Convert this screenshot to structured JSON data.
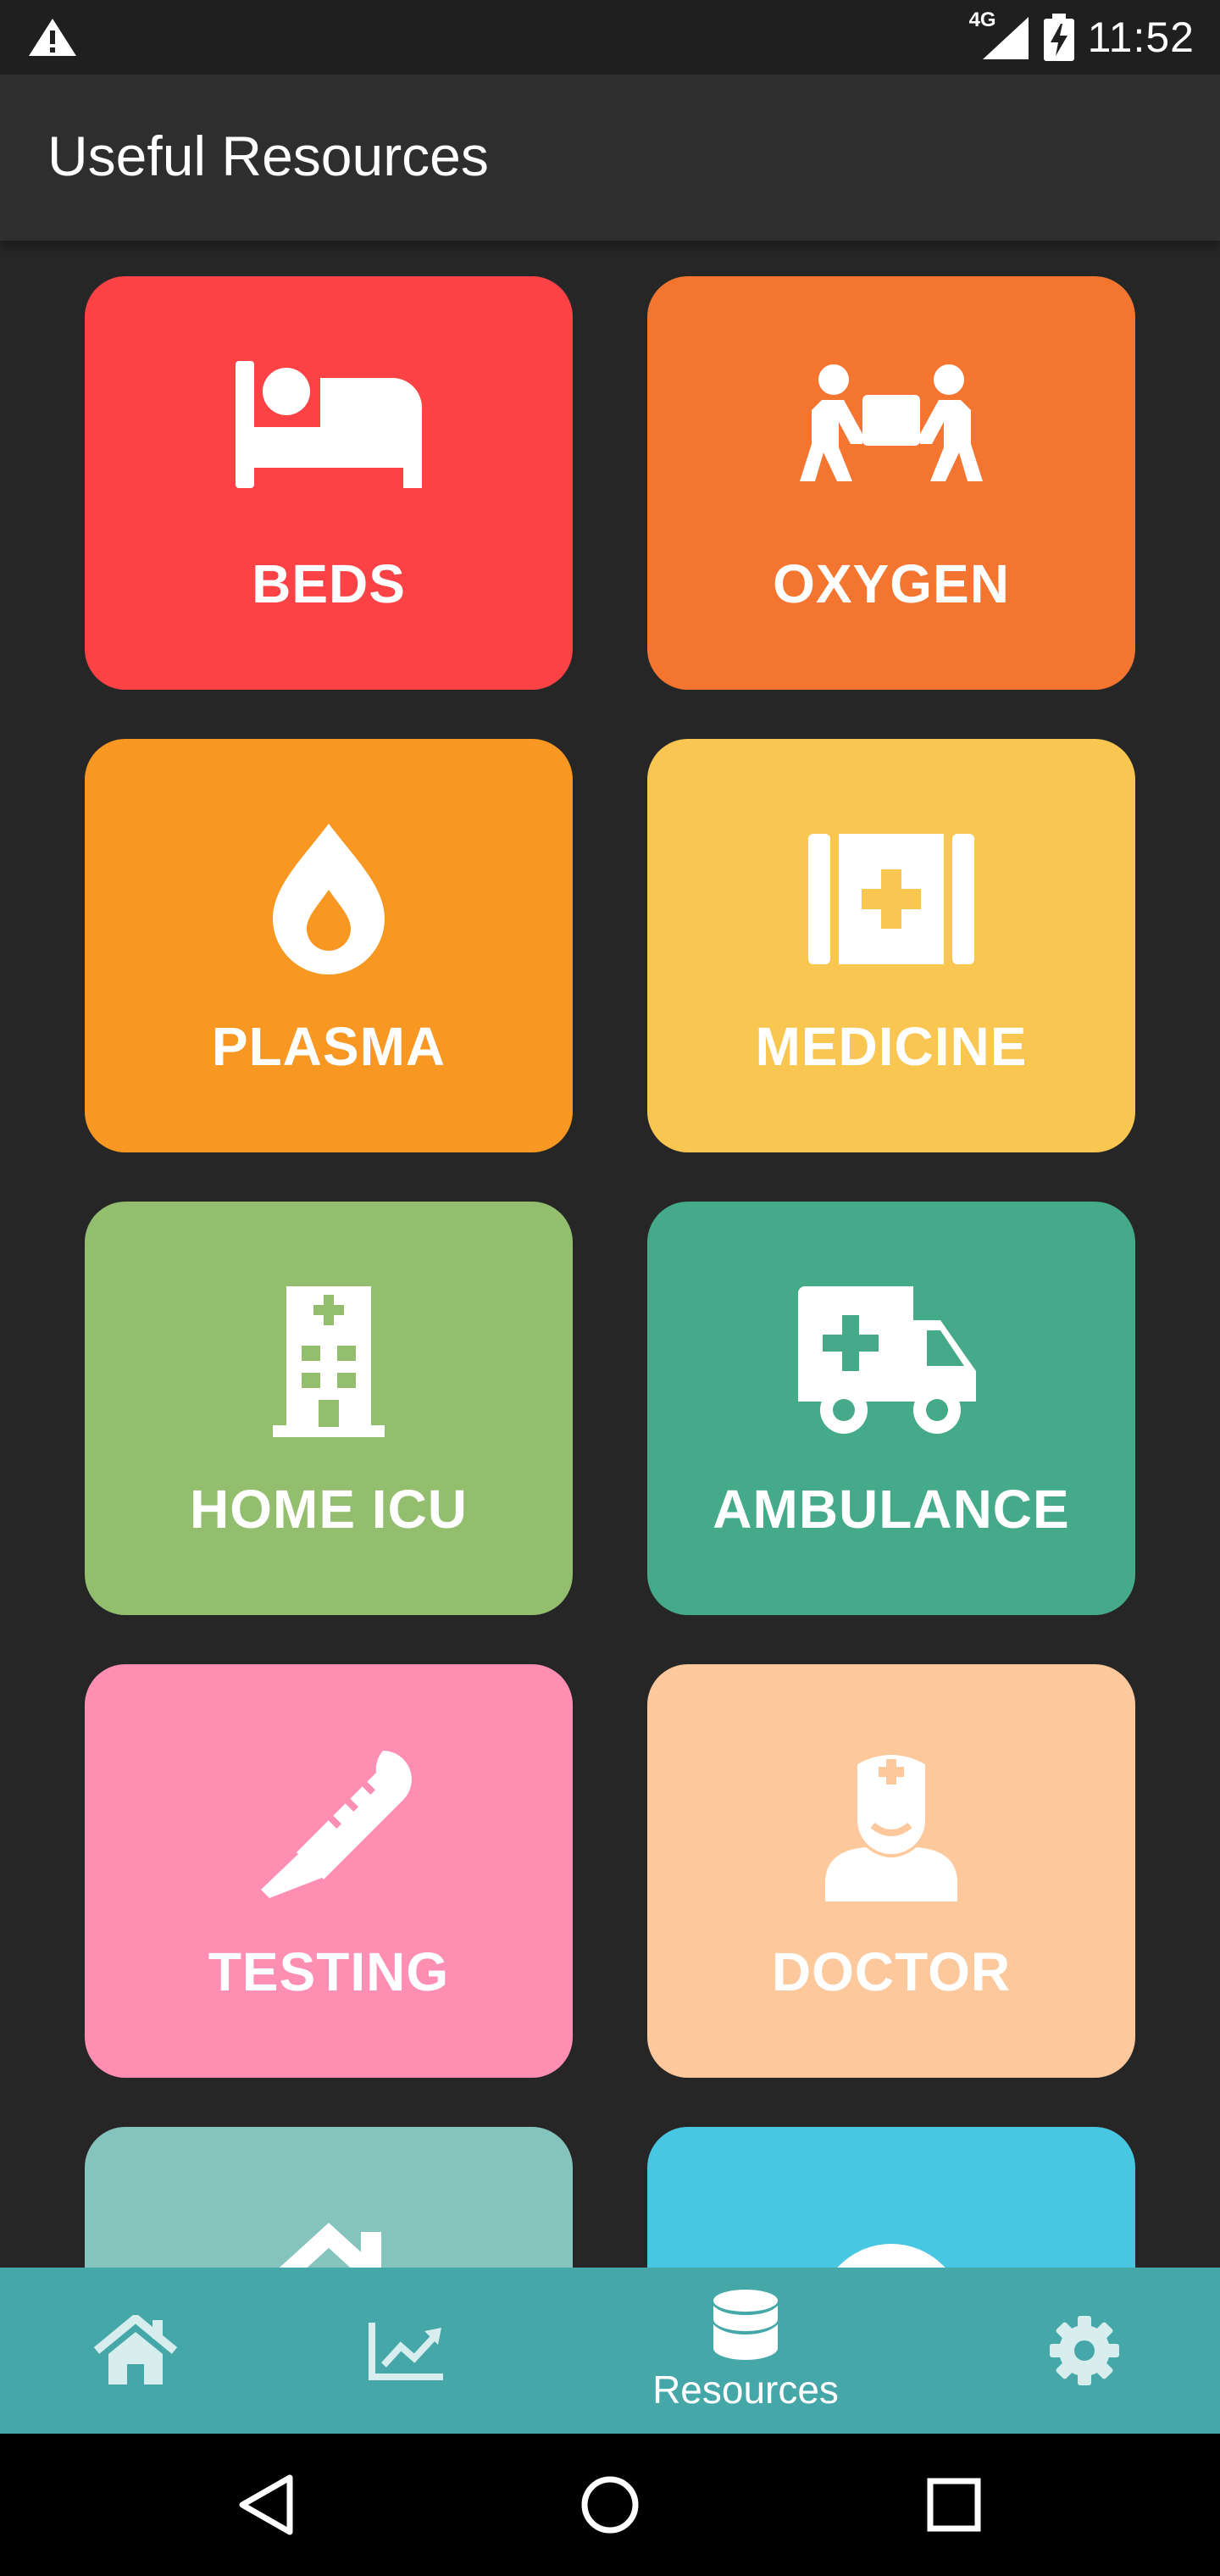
{
  "status_bar": {
    "time": "11:52",
    "network": "4G",
    "icons": [
      "warning-icon",
      "signal-icon",
      "battery-charging-icon"
    ]
  },
  "app_bar": {
    "title": "Useful Resources"
  },
  "tiles": [
    {
      "label": "BEDS",
      "icon": "bed-icon",
      "color": "#fc4245"
    },
    {
      "label": "OXYGEN",
      "icon": "people-carry-icon",
      "color": "#f37530"
    },
    {
      "label": "PLASMA",
      "icon": "drop-icon",
      "color": "#f89722"
    },
    {
      "label": "MEDICINE",
      "icon": "medkit-icon",
      "color": "#f8c651"
    },
    {
      "label": "HOME ICU",
      "icon": "hospital-icon",
      "color": "#92be6d"
    },
    {
      "label": "AMBULANCE",
      "icon": "ambulance-icon",
      "color": "#44aa8a"
    },
    {
      "label": "TESTING",
      "icon": "thermometer-icon",
      "color": "#fe8fb3"
    },
    {
      "label": "DOCTOR",
      "icon": "doctor-icon",
      "color": "#fdc89b"
    },
    {
      "label": "",
      "icon": "home-icon",
      "color": "#85c4bc"
    },
    {
      "label": "",
      "icon": "user-icon",
      "color": "#47c7e2"
    }
  ],
  "bottom_nav": {
    "items": [
      {
        "icon": "home-icon",
        "label": ""
      },
      {
        "icon": "chart-icon",
        "label": ""
      },
      {
        "icon": "database-icon",
        "label": "Resources",
        "active": true
      },
      {
        "icon": "gear-icon",
        "label": ""
      }
    ],
    "color": "#45a7a8"
  },
  "system_nav": {
    "icons": [
      "back-icon",
      "home-circle-icon",
      "recents-icon"
    ]
  }
}
